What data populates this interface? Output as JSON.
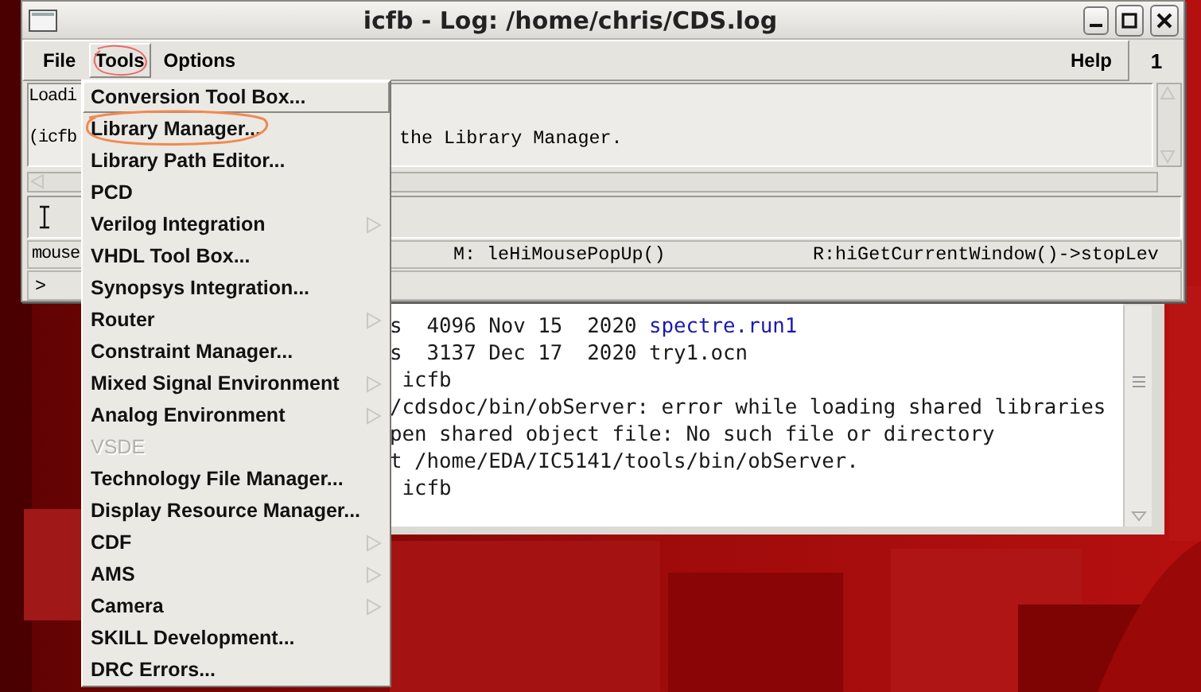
{
  "log_window": {
    "title": "icfb - Log: /home/chris/CDS.log",
    "menubar": [
      {
        "label": "File",
        "selected": false,
        "circled": false
      },
      {
        "label": "Tools",
        "selected": true,
        "circled": true
      },
      {
        "label": "Options",
        "selected": false,
        "circled": false
      }
    ],
    "help": "Help",
    "window_number": "1",
    "log_lines": [
      {
        "left": "Loadi"
      },
      {
        "left": "(icfb",
        "right": "the Library Manager."
      }
    ],
    "status": {
      "left": "mouse",
      "middle": "M: leHiMousePopUp()",
      "right": "R:hiGetCurrentWindow()->stopLev"
    },
    "prompt": ">"
  },
  "terminal": {
    "lines": [
      [
        {
          "text": "s  4096 Nov 15  2020 ",
          "kind": "plain"
        },
        {
          "text": "spectre.run1",
          "kind": "directory"
        }
      ],
      [
        {
          "text": "s  3137 Dec 17  2020 try1.ocn",
          "kind": "plain"
        }
      ],
      [
        {
          "text": " icfb",
          "kind": "plain"
        }
      ],
      [
        {
          "text": "/cdsdoc/bin/obServer: error while loading shared libraries",
          "kind": "plain"
        }
      ],
      [
        {
          "text": "pen shared object file: No such file or directory",
          "kind": "plain"
        }
      ],
      [
        {
          "text": "t /home/EDA/IC5141/tools/bin/obServer.",
          "kind": "plain"
        }
      ],
      [
        {
          "text": " icfb",
          "kind": "plain"
        }
      ]
    ]
  },
  "tools_menu": {
    "items": [
      {
        "label": "Conversion Tool Box...",
        "selected": true,
        "disabled": false,
        "has_submenu": false,
        "circled": false
      },
      {
        "label": "Library Manager...",
        "selected": false,
        "disabled": false,
        "has_submenu": false,
        "circled": true
      },
      {
        "label": "Library Path Editor...",
        "selected": false,
        "disabled": false,
        "has_submenu": false,
        "circled": false
      },
      {
        "label": "PCD",
        "selected": false,
        "disabled": false,
        "has_submenu": false,
        "circled": false
      },
      {
        "label": "Verilog Integration",
        "selected": false,
        "disabled": false,
        "has_submenu": true,
        "circled": false
      },
      {
        "label": "VHDL Tool Box...",
        "selected": false,
        "disabled": false,
        "has_submenu": false,
        "circled": false
      },
      {
        "label": "Synopsys Integration...",
        "selected": false,
        "disabled": false,
        "has_submenu": false,
        "circled": false
      },
      {
        "label": "Router",
        "selected": false,
        "disabled": false,
        "has_submenu": true,
        "circled": false
      },
      {
        "label": "Constraint Manager...",
        "selected": false,
        "disabled": false,
        "has_submenu": false,
        "circled": false
      },
      {
        "label": "Mixed Signal Environment",
        "selected": false,
        "disabled": false,
        "has_submenu": true,
        "circled": false
      },
      {
        "label": "Analog Environment",
        "selected": false,
        "disabled": false,
        "has_submenu": true,
        "circled": false
      },
      {
        "label": "VSDE",
        "selected": false,
        "disabled": true,
        "has_submenu": false,
        "circled": false
      },
      {
        "label": "Technology File Manager...",
        "selected": false,
        "disabled": false,
        "has_submenu": false,
        "circled": false
      },
      {
        "label": "Display Resource Manager...",
        "selected": false,
        "disabled": false,
        "has_submenu": false,
        "circled": false
      },
      {
        "label": "CDF",
        "selected": false,
        "disabled": false,
        "has_submenu": true,
        "circled": false
      },
      {
        "label": "AMS",
        "selected": false,
        "disabled": false,
        "has_submenu": true,
        "circled": false
      },
      {
        "label": "Camera",
        "selected": false,
        "disabled": false,
        "has_submenu": true,
        "circled": false
      },
      {
        "label": "SKILL Development...",
        "selected": false,
        "disabled": false,
        "has_submenu": false,
        "circled": false
      },
      {
        "label": "DRC Errors...",
        "selected": false,
        "disabled": false,
        "has_submenu": false,
        "circled": false
      }
    ]
  }
}
